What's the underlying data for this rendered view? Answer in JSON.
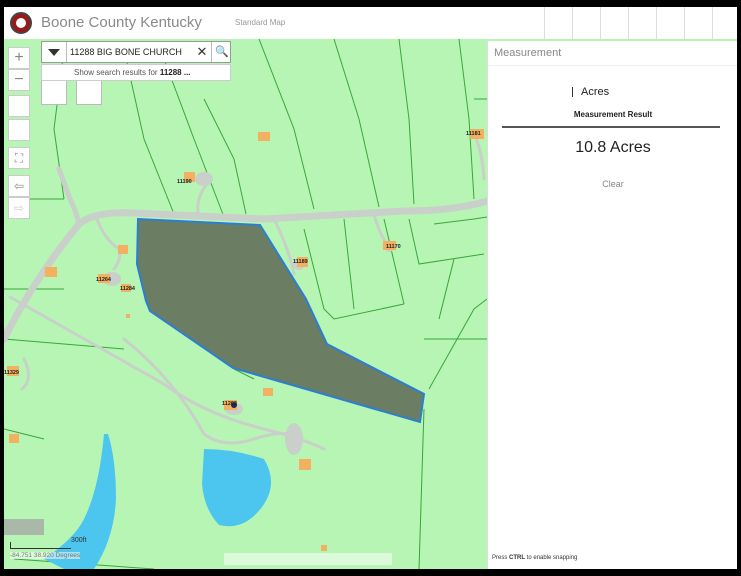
{
  "header": {
    "title": "Boone County Kentucky",
    "map_type": "Standard Map"
  },
  "search": {
    "value": "11288 BIG BONE CHURCH",
    "suggest_prefix": "Show search results for ",
    "suggest_term": "11288 ..."
  },
  "map_controls": {
    "zoom_in": "+",
    "zoom_out": "−",
    "search_button_glyph": "🔍",
    "clear_glyph": "✕"
  },
  "parcel_labels": {
    "a": "11181",
    "b": "11190",
    "c": "11170",
    "d": "11189",
    "e": "11264",
    "f": "11284",
    "g": "11329",
    "h": "11263"
  },
  "measurement": {
    "panel_title": "Measurement",
    "unit": "Acres",
    "result_heading": "Measurement Result",
    "result_value": "10.8 Acres",
    "clear_label": "Clear",
    "snap_hint_pre": "Press ",
    "snap_hint_key": "CTRL",
    "snap_hint_post": " to enable snapping"
  },
  "status": {
    "scale": "300ft",
    "coords": "-84.751 38.920 Degrees"
  },
  "colors": {
    "map_background": "#b7f5b5",
    "parcel_line": "#3aa63a",
    "road": "#c9cfc9",
    "measured_fill": "#6b7d62",
    "measured_stroke": "#2a7fd4",
    "pond": "#4cc6ef",
    "building": "#f2b060"
  }
}
